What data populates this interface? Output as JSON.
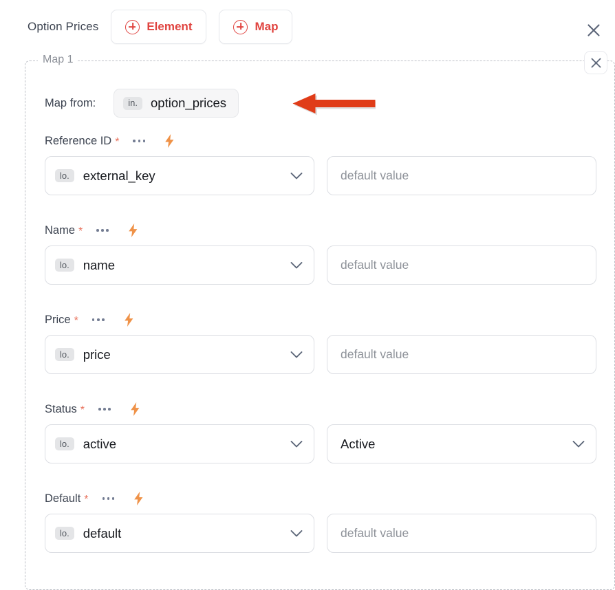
{
  "header": {
    "title": "Option Prices",
    "buttons": [
      {
        "label": "Element",
        "icon": "plus-circle-icon"
      },
      {
        "label": "Map",
        "icon": "plus-circle-icon"
      }
    ],
    "close_icon": "close-icon"
  },
  "map_group": {
    "legend": "Map 1",
    "close_icon": "close-icon",
    "map_from": {
      "label": "Map from:",
      "tag": "in.",
      "value": "option_prices"
    },
    "annotation": {
      "type": "arrow-left",
      "color": "#e03c18",
      "points_at": "option_prices"
    },
    "fields": [
      {
        "label": "Reference ID",
        "required_marker": "*",
        "menu_icon": "ellipsis-icon",
        "bolt_icon": "lightning-bolt-icon",
        "source": {
          "tag": "lo.",
          "value": "external_key",
          "chevron": "chevron-down-icon"
        },
        "target": {
          "kind": "input",
          "placeholder": "default value",
          "value": ""
        }
      },
      {
        "label": "Name",
        "required_marker": "*",
        "menu_icon": "ellipsis-icon",
        "bolt_icon": "lightning-bolt-icon",
        "source": {
          "tag": "lo.",
          "value": "name",
          "chevron": "chevron-down-icon"
        },
        "target": {
          "kind": "input",
          "placeholder": "default value",
          "value": ""
        }
      },
      {
        "label": "Price",
        "required_marker": "*",
        "menu_icon": "ellipsis-icon",
        "bolt_icon": "lightning-bolt-icon",
        "source": {
          "tag": "lo.",
          "value": "price",
          "chevron": "chevron-down-icon"
        },
        "target": {
          "kind": "input",
          "placeholder": "default value",
          "value": ""
        }
      },
      {
        "label": "Status",
        "required_marker": "*",
        "menu_icon": "ellipsis-icon",
        "bolt_icon": "lightning-bolt-icon",
        "source": {
          "tag": "lo.",
          "value": "active",
          "chevron": "chevron-down-icon"
        },
        "target": {
          "kind": "select",
          "value": "Active",
          "chevron": "chevron-down-icon"
        }
      },
      {
        "label": "Default",
        "required_marker": "*",
        "menu_icon": "ellipsis-icon",
        "bolt_icon": "lightning-bolt-icon",
        "source": {
          "tag": "lo.",
          "value": "default",
          "chevron": "chevron-down-icon"
        },
        "target": {
          "kind": "input",
          "placeholder": "default value",
          "value": ""
        }
      }
    ]
  },
  "colors": {
    "accent_red": "#e0433f",
    "required_star": "#e8705a",
    "bolt_orange": "#ef9248",
    "arrow_red": "#e03c18",
    "text_primary": "#16181d",
    "text_label": "#3d4451",
    "text_muted": "#8e9299",
    "border": "#dcdee3",
    "dashed_border": "#bcbfc6"
  }
}
